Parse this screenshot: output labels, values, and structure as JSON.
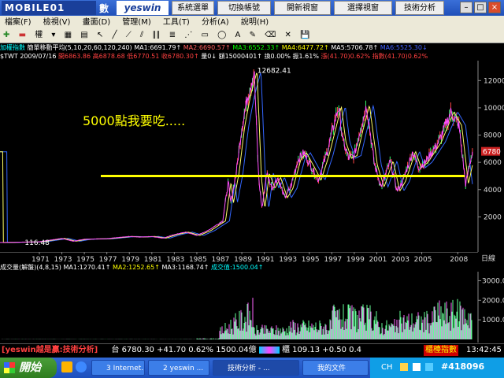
{
  "titlebar": {
    "logo": "MOBILE01",
    "logo_suffix": "數",
    "brand": "yeswin",
    "buttons": [
      "系統選單",
      "切換帳號",
      "開新視窗",
      "選擇視窗",
      "技術分析"
    ]
  },
  "menu": [
    "檔案(F)",
    "檢視(V)",
    "畫面(D)",
    "管理(M)",
    "工具(T)",
    "分析(A)",
    "說明(H)"
  ],
  "toolbar": {
    "label": "權"
  },
  "info1": {
    "title": "加權指數",
    "ma_label": "簡單移動平均(5,10,20,60,120,240)",
    "ma1": "MA1:6691.79↑",
    "ma2": "MA2:6690.57↑",
    "ma3": "MA3:6552.33↑",
    "ma4": "MA4:6477.72↑",
    "ma5": "MA5:5706.78↑",
    "ma6": "MA6:5525.30↓"
  },
  "info2": {
    "sym": "$TWT 2009/07/16",
    "open": "開6863.86",
    "high": "高6878.68",
    "low": "低6770.51",
    "close": "收6780.30↑",
    "vol": "量0↓",
    "amt": "額15000401↑",
    "rate": "換0.00%",
    "amp": "振1.61%",
    "chg": "漲(41.70)0.62%",
    "pct": "指數(41.70)0.62%"
  },
  "vol_info": {
    "title": "成交量(解盤)(4,8,15)",
    "ma1": "MA1:1270.41↑",
    "ma2": "MA2:1252.65↑",
    "ma3": "MA3:1168.74↑",
    "val": "成交值:1500.04↑"
  },
  "annotation": "5000點我要吃.....",
  "peak_label": "12682.41",
  "low_label": "116.48",
  "price_badge": "6780",
  "axis_unit": "日線",
  "status": {
    "left": "[yeswin越是贏:技術分析]",
    "tai": "台",
    "value": "6780.30 +41.70 0.62% 1500.04億",
    "gui": "櫃",
    "gui_value": "109.13 +0.50 0.4",
    "right": "櫃檯指數",
    "time": "13:42:45"
  },
  "taskbar": {
    "start": "開始",
    "tasks": [
      "3 Internet...",
      "2 yeswin ...",
      "技術分析 - ...",
      "我的文件"
    ],
    "lang": "CH",
    "watermark": "#418096"
  },
  "chart_data": [
    {
      "type": "line",
      "x_tick_labels": [
        "1971",
        "1973",
        "1975",
        "1977",
        "1979",
        "1981",
        "1983",
        "1985",
        "1987",
        "1989",
        "1991",
        "1993",
        "1995",
        "1997",
        "1999",
        "2001",
        "2003",
        "2005",
        "2008"
      ],
      "y_tick_labels": [
        "12000",
        "10000",
        "8000",
        "6000",
        "4000",
        "2000"
      ],
      "ylim": [
        0,
        13000
      ],
      "xlim": [
        1967.5,
        2010
      ],
      "grid": false,
      "reference_line": {
        "value": 5000,
        "color": "#ffff00"
      },
      "series": [
        {
          "color": "#ff4fff",
          "points": [
            [
              1967.5,
              120
            ],
            [
              1969,
              140
            ],
            [
              1971,
              170
            ],
            [
              1973,
              420
            ],
            [
              1974,
              210
            ],
            [
              1975,
              360
            ],
            [
              1977,
              400
            ],
            [
              1979,
              560
            ],
            [
              1980,
              520
            ],
            [
              1981,
              560
            ],
            [
              1982,
              440
            ],
            [
              1983,
              700
            ],
            [
              1984,
              880
            ],
            [
              1985,
              640
            ],
            [
              1986,
              1000
            ],
            [
              1987.3,
              1700
            ],
            [
              1987.8,
              4600
            ],
            [
              1988,
              3000
            ],
            [
              1988.5,
              5200
            ],
            [
              1989,
              8600
            ],
            [
              1989.5,
              10800
            ],
            [
              1990.1,
              12682
            ],
            [
              1990.5,
              4800
            ],
            [
              1990.8,
              2600
            ],
            [
              1991.2,
              5200
            ],
            [
              1991.7,
              4100
            ],
            [
              1992.2,
              4900
            ],
            [
              1992.8,
              3400
            ],
            [
              1993.3,
              4100
            ],
            [
              1994,
              6200
            ],
            [
              1994.5,
              6700
            ],
            [
              1995.3,
              5500
            ],
            [
              1995.8,
              4700
            ],
            [
              1996.5,
              6500
            ],
            [
              1997.6,
              10100
            ],
            [
              1998,
              7500
            ],
            [
              1998.5,
              6300
            ],
            [
              1999,
              6500
            ],
            [
              1999.5,
              8300
            ],
            [
              2000.1,
              10200
            ],
            [
              2000.8,
              5800
            ],
            [
              2001.4,
              4200
            ],
            [
              2002.2,
              6100
            ],
            [
              2002.8,
              3900
            ],
            [
              2003.3,
              4600
            ],
            [
              2004.2,
              6800
            ],
            [
              2004.7,
              5600
            ],
            [
              2005.3,
              6000
            ],
            [
              2006.5,
              7500
            ],
            [
              2007.6,
              9700
            ],
            [
              2008.3,
              8700
            ],
            [
              2008.9,
              4400
            ],
            [
              2009.5,
              6780
            ]
          ]
        }
      ]
    },
    {
      "type": "bar",
      "ylim": [
        0,
        3300
      ],
      "y_tick_labels": [
        "3000.0",
        "2000.0",
        "1000.0"
      ],
      "note": "daily trading volume (億), rising from near zero in the 1980s"
    }
  ]
}
